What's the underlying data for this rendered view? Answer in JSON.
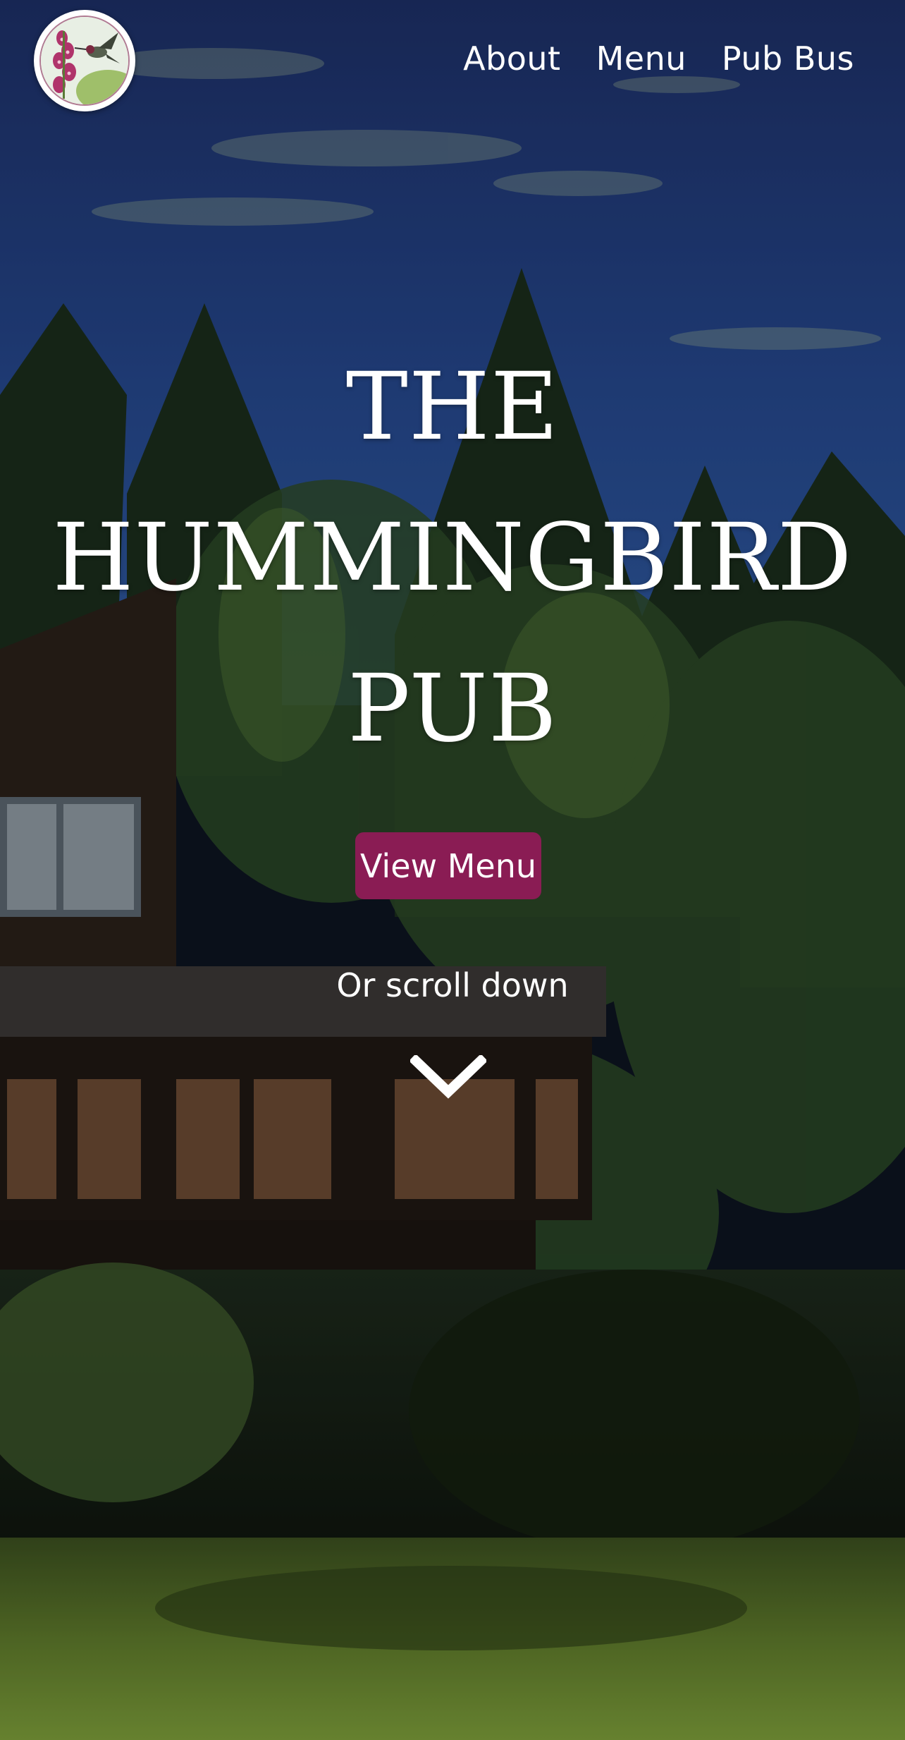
{
  "nav": {
    "items": [
      {
        "label": "About"
      },
      {
        "label": "Menu"
      },
      {
        "label": "Pub Bus"
      }
    ]
  },
  "logo": {
    "icon": "hummingbird-foxglove-logo"
  },
  "hero": {
    "title_lines": [
      "THE",
      "HUMMINGBIRD",
      "PUB"
    ],
    "cta_label": "View Menu",
    "scroll_hint": "Or scroll down",
    "scroll_icon": "chevron-down-icon"
  },
  "colors": {
    "accent": "#8a1c54",
    "text": "#ffffff",
    "sky": "#1f3a78"
  }
}
